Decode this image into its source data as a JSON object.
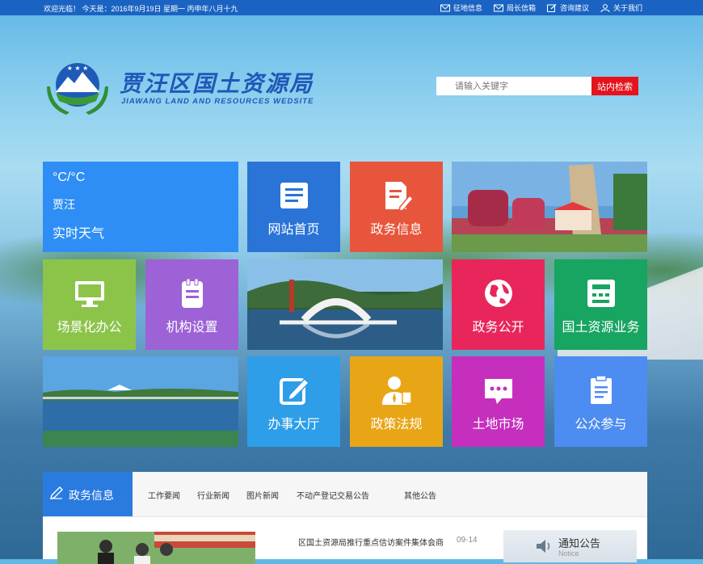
{
  "topbar": {
    "welcome": "欢迎光临！ 今天是：2016年9月19日   星期一   丙申年八月十九",
    "links": [
      {
        "label": "征地信息",
        "icon": "mail-icon"
      },
      {
        "label": "局长信箱",
        "icon": "mail-icon"
      },
      {
        "label": "咨询建议",
        "icon": "edit-icon"
      },
      {
        "label": "关于我们",
        "icon": "user-icon"
      }
    ]
  },
  "logo": {
    "cn": "贾汪区国土资源局",
    "en": "JIAWANG LAND  AND RESOURCES WEDSITE"
  },
  "search": {
    "placeholder": "请输入关键字",
    "button": "站内检索"
  },
  "weather": {
    "temp": "°C/°C",
    "city": "贾汪",
    "label": "实时天气"
  },
  "tiles": [
    {
      "label": "网站首页",
      "icon": "document-icon",
      "color": "#2a74d8"
    },
    {
      "label": "政务信息",
      "icon": "edit-document-icon",
      "color": "#e8553d"
    },
    {
      "label": "场景化办公",
      "icon": "monitor-icon",
      "color": "#8cc44a"
    },
    {
      "label": "机构设置",
      "icon": "clipboard-icon",
      "color": "#9c62d6"
    },
    {
      "label": "政务公开",
      "icon": "globe-icon",
      "color": "#e8265b"
    },
    {
      "label": "国土资源业务",
      "icon": "calculator-icon",
      "color": "#17a561"
    },
    {
      "label": "办事大厅",
      "icon": "pencil-square-icon",
      "color": "#2e9ee8"
    },
    {
      "label": "政策法规",
      "icon": "person-icon",
      "color": "#e8a617"
    },
    {
      "label": "土地市场",
      "icon": "chat-icon",
      "color": "#c62fbe"
    },
    {
      "label": "公众参与",
      "icon": "notepad-icon",
      "color": "#4d8cf0"
    }
  ],
  "news": {
    "title": "政务信息",
    "tabs": [
      "工作要闻",
      "行业新闻",
      "图片新闻",
      "不动产登记交易公告",
      "其他公告"
    ],
    "items": [
      {
        "text": "区国土资源局推行重点信访案件集体会商",
        "date": "09-14"
      }
    ],
    "notice": {
      "title": "通知公告",
      "subtitle": "Notice"
    }
  }
}
